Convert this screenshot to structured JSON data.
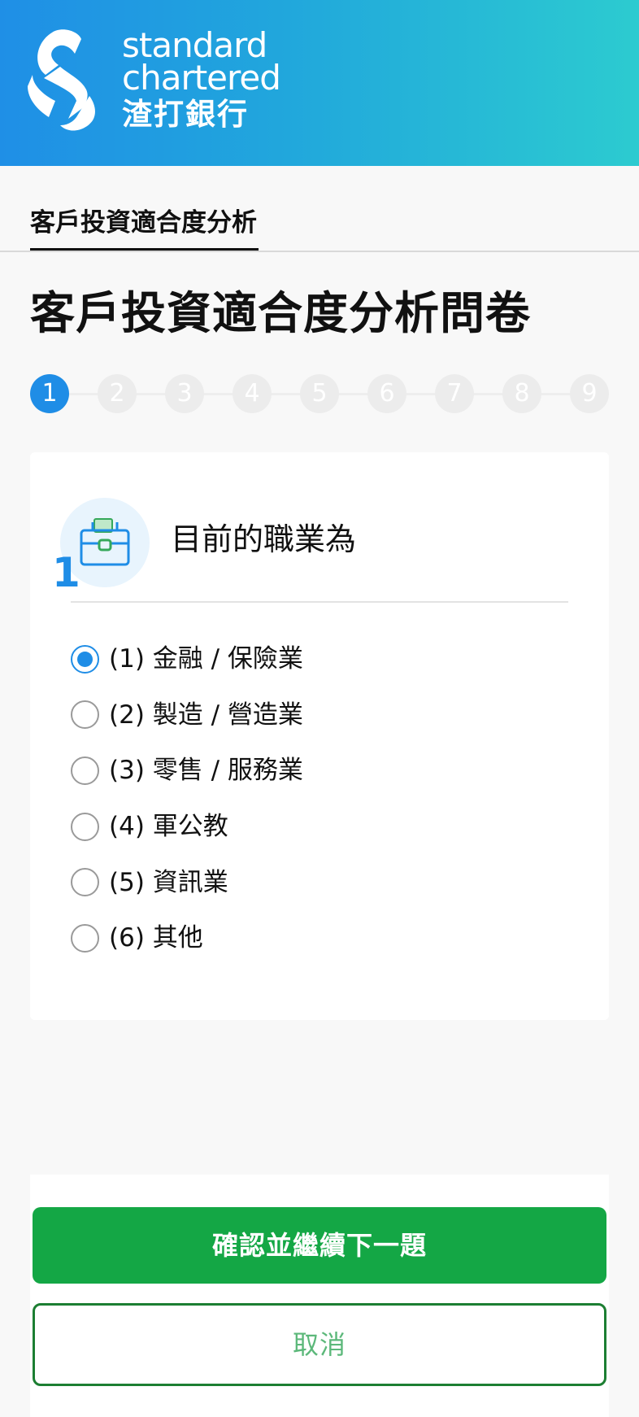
{
  "brand": {
    "name_line1": "standard",
    "name_line2": "chartered",
    "name_zh": "渣打銀行",
    "logo_icon": "standard-chartered-logo",
    "gradient_start": "#1f8fe6",
    "gradient_end": "#2ccbd0"
  },
  "tabs": [
    {
      "label": "客戶投資適合度分析",
      "active": true
    }
  ],
  "page_title": "客戶投資適合度分析問卷",
  "stepper": {
    "current": 1,
    "steps": [
      "1",
      "2",
      "3",
      "4",
      "5",
      "6",
      "7",
      "8",
      "9"
    ],
    "active_color": "#1f8de6",
    "inactive_color": "#ececec"
  },
  "question": {
    "number": "1",
    "icon": "toolbox-icon",
    "text": "目前的職業為",
    "options": [
      {
        "label": "(1) 金融 / 保險業",
        "selected": true
      },
      {
        "label": "(2) 製造 / 營造業",
        "selected": false
      },
      {
        "label": "(3) 零售 / 服務業",
        "selected": false
      },
      {
        "label": "(4) 軍公教",
        "selected": false
      },
      {
        "label": "(5) 資訊業",
        "selected": false
      },
      {
        "label": "(6) 其他",
        "selected": false
      }
    ]
  },
  "actions": {
    "confirm_label": "確認並繼續下一題",
    "cancel_label": "取消",
    "confirm_color": "#14a745",
    "cancel_border_color": "#1c7e32"
  }
}
